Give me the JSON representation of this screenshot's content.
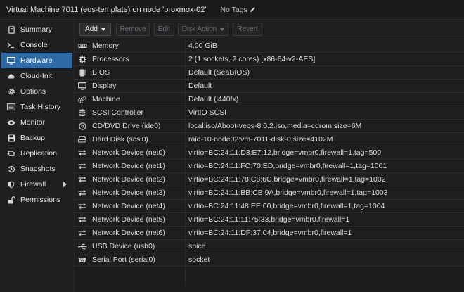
{
  "header": {
    "title": "Virtual Machine 7011 (eos-template) on node 'proxmox-02'",
    "tags_label": "No Tags"
  },
  "sidebar": {
    "items": [
      {
        "label": "Summary",
        "icon": "book-icon"
      },
      {
        "label": "Console",
        "icon": "terminal-icon"
      },
      {
        "label": "Hardware",
        "icon": "monitor-icon",
        "active": true
      },
      {
        "label": "Cloud-Init",
        "icon": "cloud-icon"
      },
      {
        "label": "Options",
        "icon": "gear-icon"
      },
      {
        "label": "Task History",
        "icon": "list-icon"
      },
      {
        "label": "Monitor",
        "icon": "eye-icon"
      },
      {
        "label": "Backup",
        "icon": "floppy-icon"
      },
      {
        "label": "Replication",
        "icon": "retweet-icon"
      },
      {
        "label": "Snapshots",
        "icon": "history-icon"
      },
      {
        "label": "Firewall",
        "icon": "shield-icon",
        "expandable": true
      },
      {
        "label": "Permissions",
        "icon": "unlock-icon"
      }
    ]
  },
  "toolbar": {
    "add": "Add",
    "remove": "Remove",
    "edit": "Edit",
    "disk_action": "Disk Action",
    "revert": "Revert"
  },
  "hardware": [
    {
      "name": "Memory",
      "value": "4.00 GiB",
      "icon": "memory-icon"
    },
    {
      "name": "Processors",
      "value": "2 (1 sockets, 2 cores) [x86-64-v2-AES]",
      "icon": "cpu-icon"
    },
    {
      "name": "BIOS",
      "value": "Default (SeaBIOS)",
      "icon": "chip-icon"
    },
    {
      "name": "Display",
      "value": "Default",
      "icon": "desktop-icon"
    },
    {
      "name": "Machine",
      "value": "Default (i440fx)",
      "icon": "cogs-icon"
    },
    {
      "name": "SCSI Controller",
      "value": "VirtIO SCSI",
      "icon": "database-icon"
    },
    {
      "name": "CD/DVD Drive (ide0)",
      "value": "local:iso/Aboot-veos-8.0.2.iso,media=cdrom,size=6M",
      "icon": "cdrom-icon"
    },
    {
      "name": "Hard Disk (scsi0)",
      "value": "raid-10-node02:vm-7011-disk-0,size=4102M",
      "icon": "harddisk-icon"
    },
    {
      "name": "Network Device (net0)",
      "value": "virtio=BC:24:11:D3:E7:12,bridge=vmbr0,firewall=1,tag=500",
      "icon": "network-icon"
    },
    {
      "name": "Network Device (net1)",
      "value": "virtio=BC:24:11:FC:70:ED,bridge=vmbr0,firewall=1,tag=1001",
      "icon": "network-icon"
    },
    {
      "name": "Network Device (net2)",
      "value": "virtio=BC:24:11:78:C8:6C,bridge=vmbr0,firewall=1,tag=1002",
      "icon": "network-icon"
    },
    {
      "name": "Network Device (net3)",
      "value": "virtio=BC:24:11:BB:CB:9A,bridge=vmbr0,firewall=1,tag=1003",
      "icon": "network-icon"
    },
    {
      "name": "Network Device (net4)",
      "value": "virtio=BC:24:11:48:EE:00,bridge=vmbr0,firewall=1,tag=1004",
      "icon": "network-icon"
    },
    {
      "name": "Network Device (net5)",
      "value": "virtio=BC:24:11:11:75:33,bridge=vmbr0,firewall=1",
      "icon": "network-icon"
    },
    {
      "name": "Network Device (net6)",
      "value": "virtio=BC:24:11:DF:37:04,bridge=vmbr0,firewall=1",
      "icon": "network-icon"
    },
    {
      "name": "USB Device (usb0)",
      "value": "spice",
      "icon": "usb-icon"
    },
    {
      "name": "Serial Port (serial0)",
      "value": "socket",
      "icon": "serial-icon"
    }
  ],
  "colors": {
    "accent": "#2f6aa8",
    "background": "#1c1c1e"
  }
}
